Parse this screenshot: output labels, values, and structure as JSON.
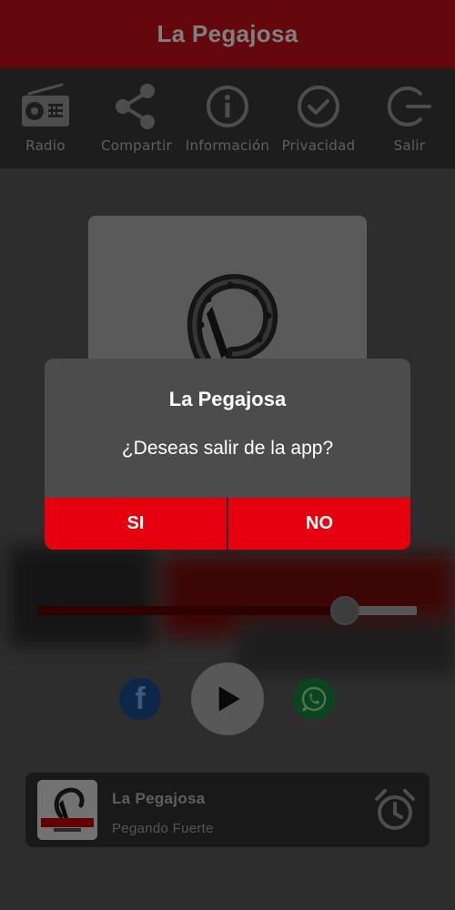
{
  "header": {
    "title": "La Pegajosa"
  },
  "toolbar": {
    "items": [
      {
        "label": "Radio",
        "icon": "radio-icon"
      },
      {
        "label": "Compartir",
        "icon": "share-icon"
      },
      {
        "label": "Información",
        "icon": "info-icon"
      },
      {
        "label": "Privacidad",
        "icon": "check-circle-icon"
      },
      {
        "label": "Salir",
        "icon": "logout-icon"
      }
    ]
  },
  "player": {
    "volume": 0.81,
    "social": {
      "facebook_glyph": "f"
    }
  },
  "now_playing": {
    "title": "La Pegajosa",
    "subtitle": "Pegando Fuerte"
  },
  "dialog": {
    "title": "La Pegajosa",
    "message": "¿Deseas salir de la app?",
    "yes_label": "SI",
    "no_label": "NO"
  },
  "colors": {
    "brand_red": "#e6000e",
    "header_red": "#c8101b",
    "toolbar_bg": "#3b3b3b"
  }
}
